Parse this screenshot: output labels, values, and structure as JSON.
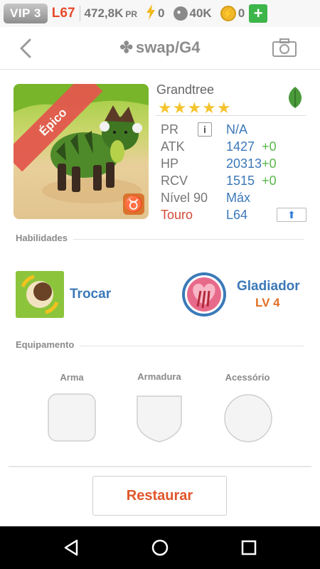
{
  "statusbar": {
    "vip_label": "VIP 3",
    "level": "L67",
    "power": "472,8K",
    "power_unit": "PR",
    "energy": "0",
    "paw_count": "40K",
    "coins": "0",
    "plus_label": "+"
  },
  "header": {
    "title": "swap/G4",
    "back_icon": "chevron-left-icon",
    "camera_icon": "camera-icon",
    "clover_icon": "clover-icon"
  },
  "monster": {
    "rarity": "Épico",
    "name": "Grandtree",
    "stars": "★★★★★",
    "star_count": 5,
    "element_icon": "leaf-icon",
    "zodiac_glyph": "♉",
    "stats": {
      "pr_label": "PR",
      "pr_info": "i",
      "pr_value": "N/A",
      "atk_label": "ATK",
      "atk_value": "1427",
      "atk_bonus": "+0",
      "hp_label": "HP",
      "hp_value": "20313",
      "hp_bonus": "+0",
      "rcv_label": "RCV",
      "rcv_value": "1515",
      "rcv_bonus": "+0",
      "level_label": "Nível 90",
      "level_value": "Máx",
      "sign_label": "Touro",
      "sign_value": "L64"
    }
  },
  "skills": {
    "section_label": "Habilidades",
    "skill1": {
      "name": "Trocar",
      "icon": "swap-icon"
    },
    "skill2": {
      "name": "Gladiador",
      "level": "LV 4",
      "icon": "gladiator-heart-icon"
    }
  },
  "equipment": {
    "section_label": "Equipamento",
    "weapon_label": "Arma",
    "armor_label": "Armadura",
    "accessory_label": "Acessório"
  },
  "actions": {
    "restore_label": "Restaurar"
  },
  "colors": {
    "accent_blue": "#3c78b8",
    "accent_red": "#e0562a",
    "bonus_green": "#5ab84b",
    "star_yellow": "#f4c430"
  }
}
